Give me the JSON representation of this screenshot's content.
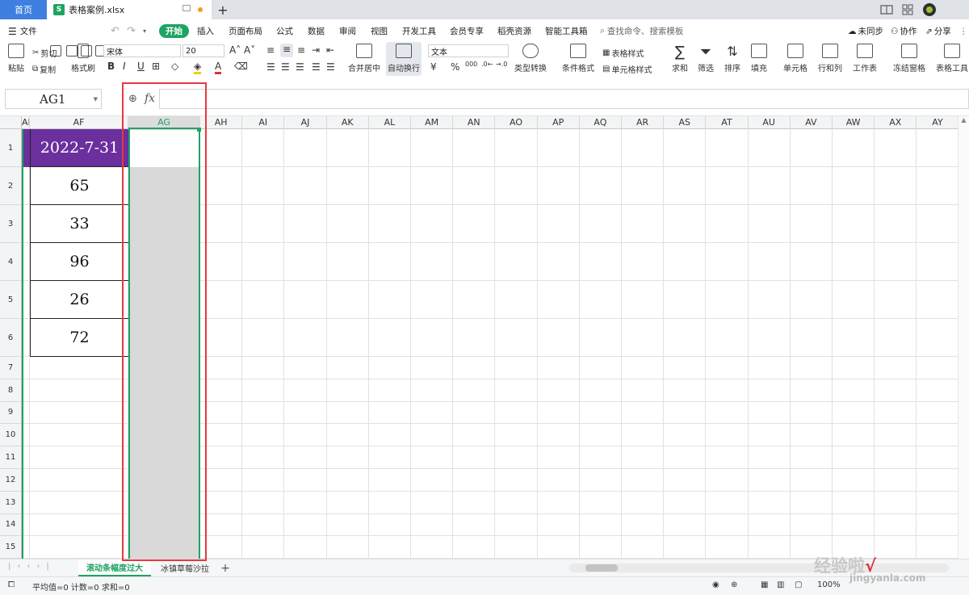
{
  "titlebar": {
    "home_tab": "首页",
    "file_badge": "S",
    "file_tab": "表格案例.xlsx",
    "new_tab": "+"
  },
  "menu": {
    "file": "文件",
    "items": [
      "开始",
      "插入",
      "页面布局",
      "公式",
      "数据",
      "审阅",
      "视图",
      "开发工具",
      "会员专享",
      "稻壳资源",
      "智能工具箱"
    ],
    "search_placeholder": "查找命令、搜索模板",
    "right": [
      "未同步",
      "协作",
      "分享"
    ]
  },
  "ribbon": {
    "paste": "粘贴",
    "cut": "剪切",
    "copy": "复制",
    "format_painter": "格式刷",
    "font_name": "宋体",
    "font_size": "20",
    "bold": "B",
    "italic": "I",
    "underline": "U",
    "merge_center": "合并居中",
    "wrap_text": "自动换行",
    "number_format": "文本",
    "type_convert": "类型转换",
    "cond_format": "条件格式",
    "table_style": "表格样式",
    "cell_style": "单元格样式",
    "sum": "求和",
    "filter": "筛选",
    "sort": "排序",
    "fill": "填充",
    "cell": "单元格",
    "row_col": "行和列",
    "worksheet": "工作表",
    "freeze": "冻结窗格",
    "table_tools": "表格工具"
  },
  "formula_bar": {
    "name_box": "AG1",
    "fx_label": "fx",
    "formula": ""
  },
  "grid": {
    "columns": [
      "AE",
      "AF",
      "AG",
      "AH",
      "AI",
      "AJ",
      "AK",
      "AL",
      "AM",
      "AN",
      "AO",
      "AP",
      "AQ",
      "AR",
      "AS",
      "AT",
      "AU",
      "AV",
      "AW",
      "AX",
      "AY"
    ],
    "rows": [
      "1",
      "2",
      "3",
      "4",
      "5",
      "6",
      "7",
      "8",
      "9",
      "10",
      "11",
      "12",
      "13",
      "14",
      "15"
    ],
    "af_values": [
      "2022-7-31",
      "65",
      "33",
      "96",
      "26",
      "72"
    ],
    "selected_column": "AG",
    "header_fill": "#6b2f9e",
    "selection_color": "#1ea363"
  },
  "sheets": {
    "tabs": [
      "滚动条幅度过大",
      "冰镇草莓沙拉"
    ],
    "active": "滚动条幅度过大",
    "add": "+"
  },
  "status": {
    "summary": "平均值=0  计数=0  求和=0",
    "zoom": "100%"
  },
  "watermark": {
    "main": "经验啦",
    "check": "√",
    "sub": "jingyanla.com"
  }
}
